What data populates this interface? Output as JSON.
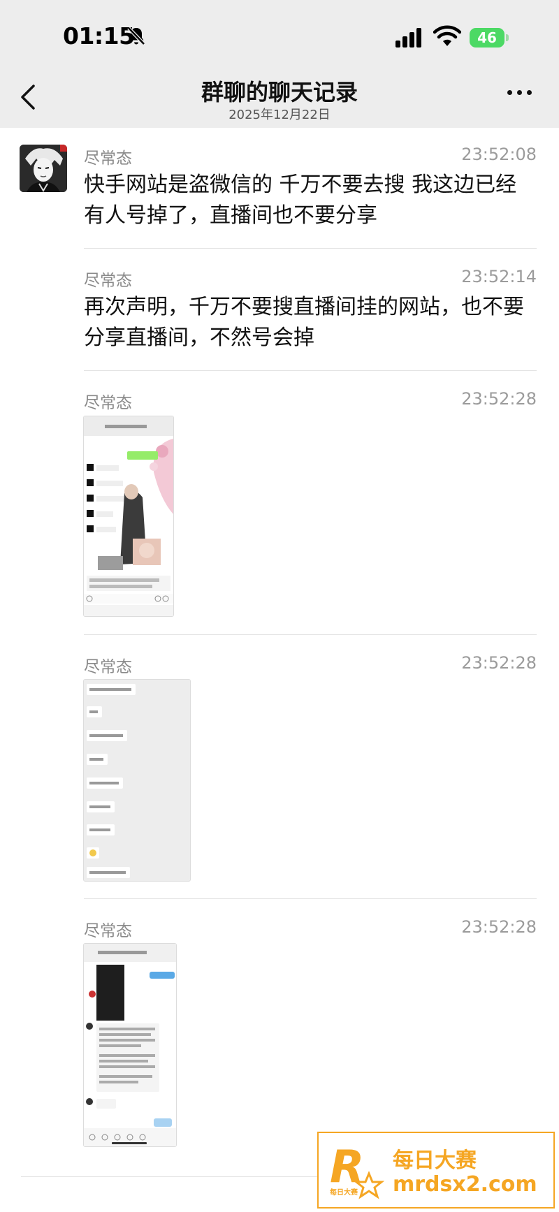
{
  "status_bar": {
    "time": "01:15",
    "battery": "46"
  },
  "header": {
    "title": "群聊的聊天记录",
    "date": "2025年12月22日"
  },
  "messages": [
    {
      "sender": "尽常态",
      "time": "23:52:08",
      "text": "快手网站是盗微信的 千万不要去搜 我这边已经有人号掉了，直播间也不要分享"
    },
    {
      "sender": "尽常态",
      "time": "23:52:14",
      "text": "再次声明，千万不要搜直播间挂的网站，也不要分享直播间，不然号会掉"
    },
    {
      "sender": "尽常态",
      "time": "23:52:28"
    },
    {
      "sender": "尽常态",
      "time": "23:52:28"
    },
    {
      "sender": "尽常态",
      "time": "23:52:28"
    }
  ],
  "watermark": {
    "name": "每日大赛",
    "url": "mrdsx2.com",
    "logo_text": "每日大赛"
  },
  "colors": {
    "header_bg": "#ededed",
    "green_bubble": "#95ec69",
    "watermark": "#f5a623",
    "battery": "#4cd964"
  }
}
